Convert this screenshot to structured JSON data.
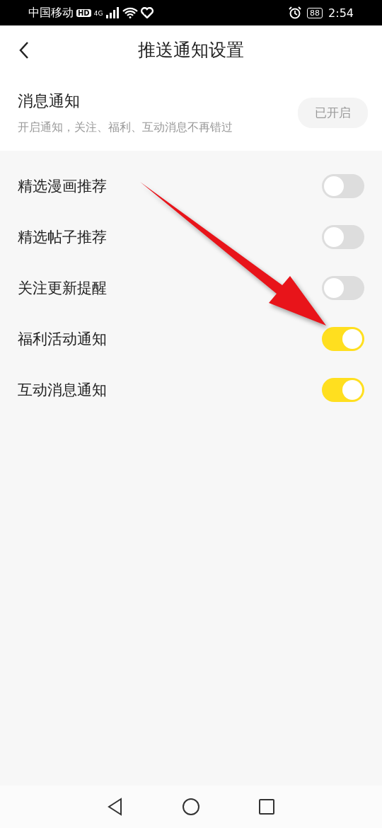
{
  "status_bar": {
    "carrier": "中国移动",
    "hd": "HD",
    "network": "4G",
    "battery": "88",
    "time": "2:54"
  },
  "header": {
    "title": "推送通知设置"
  },
  "notification": {
    "title": "消息通知",
    "description": "开启通知，关注、福利、互动消息不再错过",
    "button": {
      "label": "已开启",
      "disabled": true
    }
  },
  "settings": [
    {
      "label": "精选漫画推荐",
      "on": false
    },
    {
      "label": "精选帖子推荐",
      "on": false
    },
    {
      "label": "关注更新提醒",
      "on": false
    },
    {
      "label": "福利活动通知",
      "on": true
    },
    {
      "label": "互动消息通知",
      "on": true
    }
  ]
}
